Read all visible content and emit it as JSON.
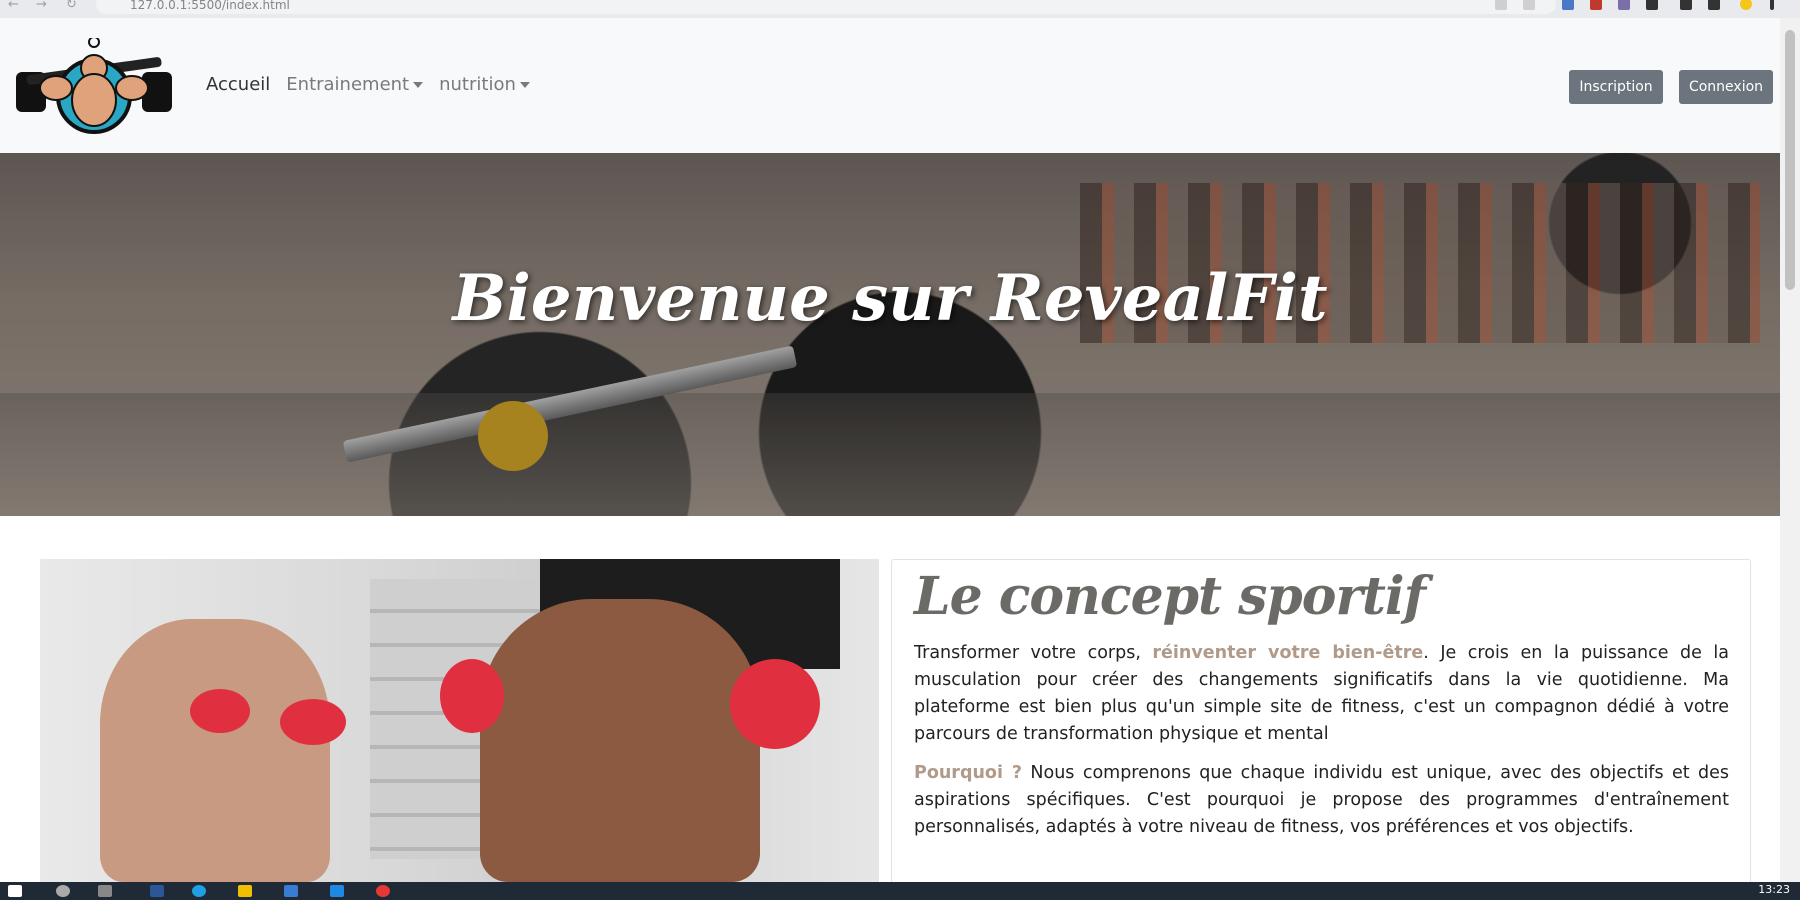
{
  "browser": {
    "url": "127.0.0.1:5500/index.html",
    "nav_back": "←",
    "nav_forward": "→",
    "nav_reload": "↻"
  },
  "header": {
    "logo_icon": "bodybuilder-logo-icon",
    "nav": [
      {
        "label": "Accueil",
        "active": true
      },
      {
        "label": "Entrainement",
        "dropdown": true
      },
      {
        "label": "nutrition",
        "dropdown": true
      }
    ],
    "signup_label": "Inscription",
    "login_label": "Connexion"
  },
  "hero": {
    "title": "Bienvenue sur RevealFit"
  },
  "concept": {
    "title": "Le concept sportif",
    "p1_start": "Transformer votre corps, ",
    "p1_highlight": "réinventer votre bien-être",
    "p1_end": ". Je crois en la puissance de la musculation pour créer des changements significatifs dans la vie quotidienne. Ma plateforme est bien plus qu'un simple site de fitness, c'est un compagnon dédié à votre parcours de transformation physique et mental",
    "p2_highlight": "Pourquoi ?",
    "p2_text": " Nous comprenons que chaque individu est unique, avec des objectifs et des aspirations spécifiques. C'est pourquoi je propose des programmes d'entraînement personnalisés, adaptés à votre niveau de fitness, vos préférences et vos objectifs."
  },
  "taskbar": {
    "time": "13:23"
  },
  "colors": {
    "navbar_bg": "#f8f9fa",
    "button_bg": "#6c757d",
    "highlight": "#b09a8a",
    "title_gray": "#6c6a66"
  }
}
